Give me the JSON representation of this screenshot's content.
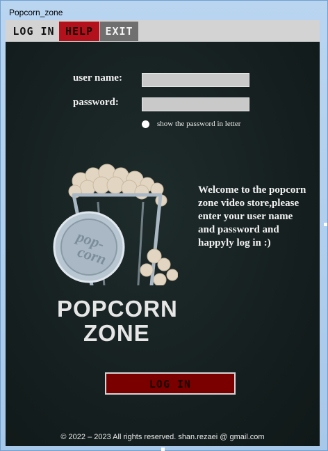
{
  "window": {
    "title": "Popcorn_zone"
  },
  "menu": [
    {
      "label": "LOG IN"
    },
    {
      "label": "HELP"
    },
    {
      "label": "EXIT"
    }
  ],
  "form": {
    "username_label": "user name:",
    "username_value": "",
    "password_label": "password:",
    "password_value": "",
    "show_password_label": "show the password in letter",
    "login_button": "LOG IN"
  },
  "welcome": "Welcome to the popcorn zone video store,please enter your user name and password and happyly log in :)",
  "logo": {
    "badge_line1": "pop-",
    "badge_line2": "corn",
    "word1": "POPCORN",
    "word2": "ZONE"
  },
  "footer": "© 2022 – 2023 All rights reserved. shan.rezaei @ gmail.com",
  "colors": {
    "background": "#162020",
    "help_red": "#b3121c",
    "login_button": "#7a0000",
    "exit_gray": "#6f6f6f"
  }
}
